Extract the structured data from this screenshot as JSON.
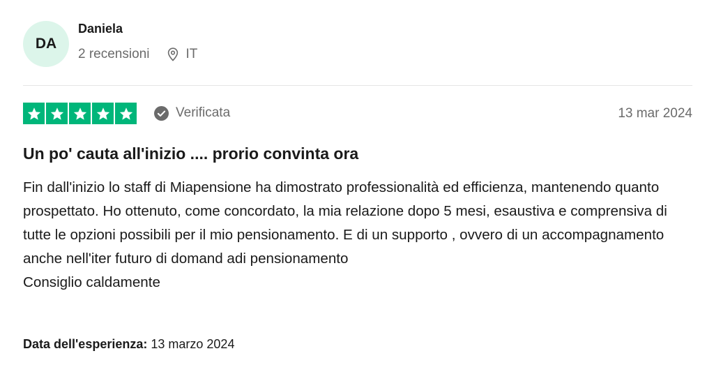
{
  "consumer": {
    "initials": "DA",
    "name": "Daniela",
    "reviews_count": "2 recensioni",
    "country": "IT",
    "avatar_color": "#dcf5ea"
  },
  "review": {
    "rating": 5,
    "max_rating": 5,
    "star_color": "#00b67a",
    "verified_label": "Verificata",
    "date": "13 mar 2024",
    "title": "Un po' cauta all'inizio .... prorio convinta ora",
    "body_paragraph_1": "Fin dall'inizio lo staff di Miapensione ha dimostrato professionalità ed efficienza, mantenendo quanto prospettato. Ho ottenuto, come concordato, la mia relazione dopo 5 mesi, esaustiva e comprensiva di tutte le opzioni possibili per il mio pensionamento. E di un supporto , ovvero di un accompagnamento anche nell'iter futuro di domand adi pensionamento",
    "body_paragraph_2": "Consiglio caldamente",
    "experience_label": "Data dell'esperienza:",
    "experience_date": "13 marzo 2024"
  },
  "icons": {
    "location": "location-pin-icon",
    "verified": "verified-check-icon",
    "star": "star-icon"
  }
}
